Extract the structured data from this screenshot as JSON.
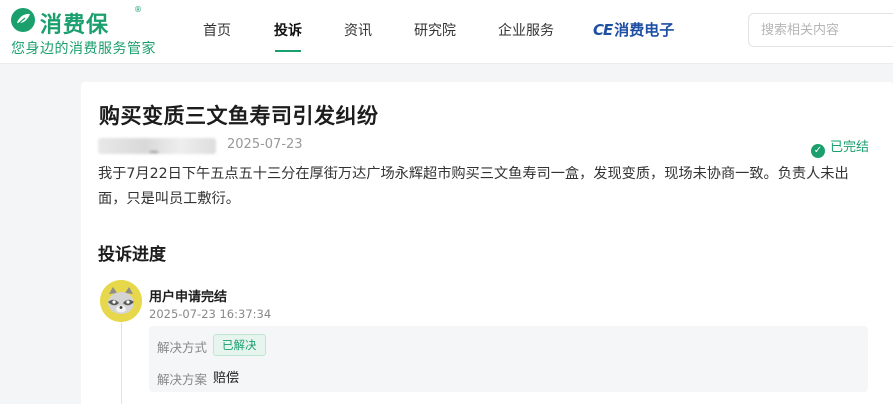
{
  "brand": {
    "name": "消费保",
    "registered": "®",
    "slogan": "您身边的消费服务管家",
    "color": "#1a9f6d"
  },
  "nav": {
    "items": [
      {
        "label": "首页",
        "active": false
      },
      {
        "label": "投诉",
        "active": true
      },
      {
        "label": "资讯",
        "active": false
      },
      {
        "label": "研究院",
        "active": false
      },
      {
        "label": "企业服务",
        "active": false
      }
    ],
    "partner": {
      "mark": "CE",
      "text": "消费电子",
      "color": "#1e4fa3"
    }
  },
  "search": {
    "placeholder": "搜索相关内容",
    "icon": "search-icon"
  },
  "complaint": {
    "title": "购买变质三文鱼寿司引发纠纷",
    "date": "2025-07-23",
    "status": "已完结",
    "status_icon": "check-circle-icon",
    "description": "我于7月22日下午五点五十三分在厚街万达广场永辉超市购买三文鱼寿司一盒，发现变质，现场未协商一致。负责人未出面，只是叫员工敷衍。"
  },
  "progress": {
    "heading": "投诉进度",
    "steps": [
      {
        "title": "用户申请完结",
        "time": "2025-07-23 16:37:34",
        "avatar_icon": "raccoon-avatar-icon",
        "details": {
          "method_label": "解决方式",
          "method_value": "已解决",
          "plan_label": "解决方案",
          "plan_value": "赔偿"
        }
      }
    ]
  }
}
